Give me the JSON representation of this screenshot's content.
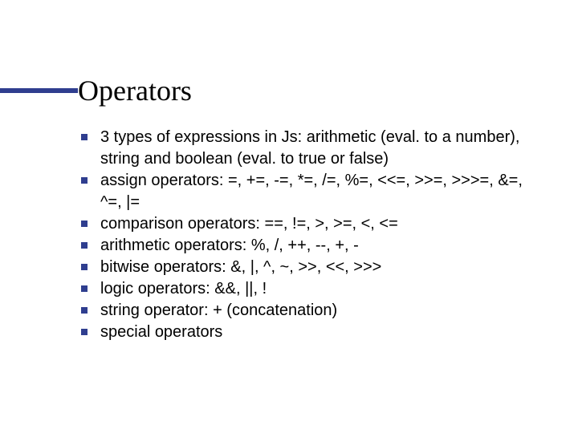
{
  "slide": {
    "title": "Operators",
    "bullets": [
      "3 types of expressions in Js: arithmetic (eval. to a number), string and boolean (eval. to true or false)",
      "assign operators: =, +=, -=, *=, /=, %=, <<=, >>=, >>>=, &=, ^=, |=",
      "comparison operators: ==, !=, >, >=, <, <=",
      "arithmetic operators: %, /, ++, --, +, -",
      "bitwise operators: &, |, ^, ~, >>, <<, >>>",
      "logic operators: &&, ||, !",
      "string operator: + (concatenation)",
      "special operators"
    ]
  }
}
